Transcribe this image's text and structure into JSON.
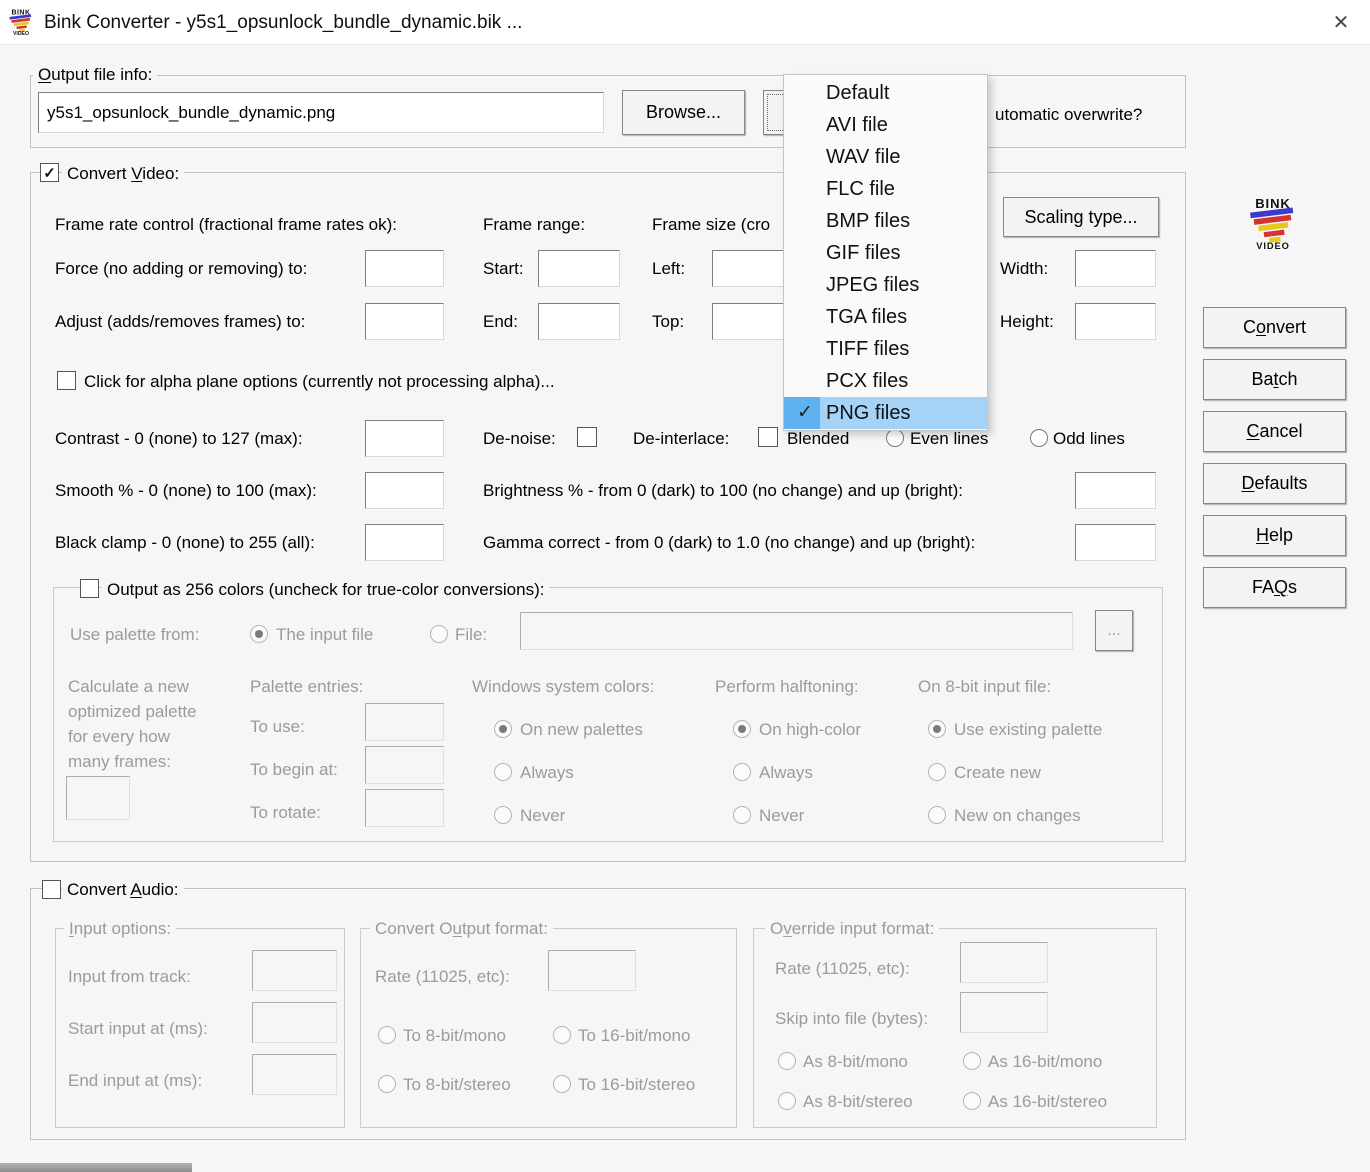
{
  "window": {
    "title": "Bink Converter - y5s1_opsunlock_bundle_dynamic.bik ...",
    "brand_top": "BINK",
    "brand_bottom": "VIDEO"
  },
  "icons": {
    "close": "✕",
    "menu_check": "✓",
    "checkbox_check": "✓"
  },
  "output_file": {
    "group_label": {
      "pre": "",
      "key": "O",
      "post": "utput file info:"
    },
    "filename": "y5s1_opsunlock_bundle_dynamic.png",
    "browse": "Browse...",
    "overwrite_fragment": "utomatic overwrite?"
  },
  "type_menu": {
    "selected": "PNG files",
    "items": [
      "Default",
      "AVI file",
      "WAV file",
      "FLC file",
      "BMP files",
      "GIF files",
      "JPEG files",
      "TGA files",
      "TIFF files",
      "PCX files",
      "PNG files"
    ]
  },
  "video": {
    "group_label": {
      "pre": "Convert ",
      "key": "V",
      "post": "ideo:"
    },
    "frame_rate_header": "Frame rate control (fractional frame rates ok):",
    "frame_range_header": "Frame range:",
    "frame_size_header_fragment": "Frame size (cro",
    "scaling_type": "Scaling type...",
    "force_label": "Force (no adding or removing) to:",
    "adjust_label": "Adjust (adds/removes frames) to:",
    "start_label": "Start:",
    "end_label": "End:",
    "left_label": "Left:",
    "top_label": "Top:",
    "width_label": "Width:",
    "height_label": "Height:",
    "alpha_label": "Click for alpha plane options (currently not processing alpha)...",
    "contrast_label": "Contrast - 0 (none) to 127 (max):",
    "denoise_label": "De-noise:",
    "deinterlace_label": "De-interlace:",
    "blended_label": "Blended",
    "even_lines_label": "Even lines",
    "odd_lines_label": "Odd lines",
    "smooth_label": "Smooth % - 0 (none) to 100 (max):",
    "brightness_label": "Brightness % - from 0 (dark) to 100 (no change) and up (bright):",
    "black_clamp_label": "Black clamp - 0 (none) to 255 (all):",
    "gamma_label": "Gamma correct - from 0 (dark) to 1.0 (no change) and up (bright):"
  },
  "palette": {
    "group_label": "Output as 256 colors (uncheck for true-color conversions):",
    "use_palette_from": "Use palette from:",
    "the_input_file": "The input file",
    "file_label": "File:",
    "browse_ellipsis": "...",
    "calc_lines": [
      "Calculate a new",
      "optimized palette",
      "for every how",
      "many frames:"
    ],
    "palette_entries": "Palette entries:",
    "to_use": "To use:",
    "to_begin_at": "To begin at:",
    "to_rotate": "To rotate:",
    "win_colors_header": "Windows system colors:",
    "win_colors": [
      "On new palettes",
      "Always",
      "Never"
    ],
    "halftoning_header": "Perform halftoning:",
    "halftoning": [
      "On high-color",
      "Always",
      "Never"
    ],
    "bit8_header": "On 8-bit input file:",
    "bit8": [
      "Use existing palette",
      "Create new",
      "New on changes"
    ]
  },
  "audio": {
    "group_label": {
      "pre": "Convert ",
      "key": "A",
      "post": "udio:"
    },
    "input_options_label": {
      "pre": "",
      "key": "I",
      "post": "nput options:"
    },
    "input_from_track": "Input from track:",
    "start_input": "Start input at (ms):",
    "end_input": "End input at (ms):",
    "output_format_label": {
      "pre": "Convert O",
      "key": "u",
      "post": "tput format:"
    },
    "rate_label": "Rate (11025, etc):",
    "to_8_mono": "To 8-bit/mono",
    "to_16_mono": "To 16-bit/mono",
    "to_8_stereo": "To 8-bit/stereo",
    "to_16_stereo": "To 16-bit/stereo",
    "override_label": {
      "pre": "O",
      "key": "v",
      "post": "erride input format:"
    },
    "override_rate_label": "Rate (11025, etc):",
    "skip_label": "Skip into file (bytes):",
    "as_8_mono": "As 8-bit/mono",
    "as_16_mono": "As 16-bit/mono",
    "as_8_stereo": "As 8-bit/stereo",
    "as_16_stereo": "As 16-bit/stereo"
  },
  "action_buttons": {
    "convert": {
      "pre": "C",
      "key": "o",
      "post": "nvert"
    },
    "batch": {
      "pre": "Ba",
      "key": "t",
      "post": "ch"
    },
    "cancel": {
      "pre": "",
      "key": "C",
      "post": "ancel"
    },
    "defaults": {
      "pre": "",
      "key": "D",
      "post": "efaults"
    },
    "help": {
      "pre": "",
      "key": "H",
      "post": "elp"
    },
    "faqs": {
      "pre": "FA",
      "key": "Q",
      "post": "s"
    }
  },
  "colors": {
    "menu_highlight": "#a5d2f7",
    "menu_highlight_gutter": "#5fb2f2",
    "disabled_text": "#9b9b9b",
    "logo_blue": "#3a3ace",
    "logo_red": "#d23434",
    "logo_yellow": "#e9c81e"
  }
}
